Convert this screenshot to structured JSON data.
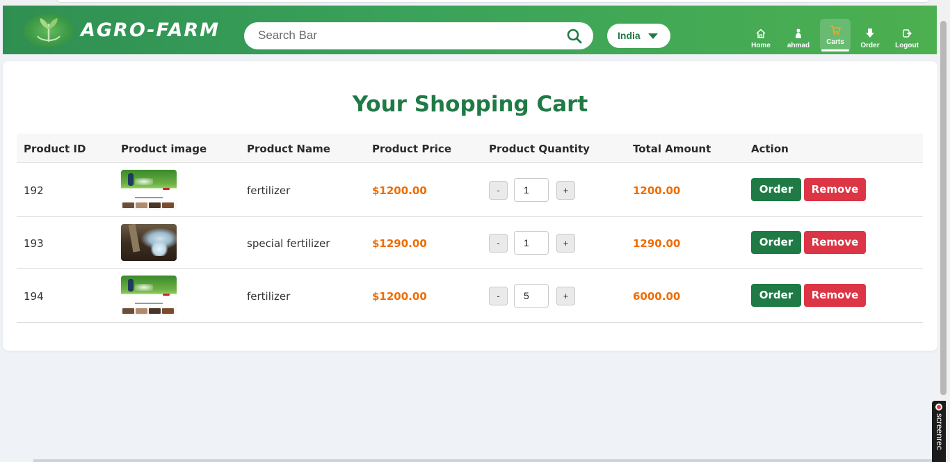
{
  "brand": {
    "name": "AGRO-FARM"
  },
  "search": {
    "placeholder": "Search Bar"
  },
  "country": {
    "selected": "India"
  },
  "nav": {
    "items": [
      {
        "label": "Home",
        "icon": "home-icon"
      },
      {
        "label": "ahmad",
        "icon": "user-icon"
      },
      {
        "label": "Carts",
        "icon": "cart-icon",
        "active": true
      },
      {
        "label": "Order",
        "icon": "order-icon"
      },
      {
        "label": "Logout",
        "icon": "logout-icon"
      }
    ]
  },
  "page": {
    "title": "Your Shopping Cart"
  },
  "table": {
    "headers": [
      "Product ID",
      "Product image",
      "Product Name",
      "Product Price",
      "Product Quantity",
      "Total Amount",
      "Action"
    ],
    "rows": [
      {
        "id": "192",
        "image": "fertilizer-field-image",
        "name": "fertilizer",
        "price": "$1200.00",
        "quantity": "1",
        "total": "1200.00"
      },
      {
        "id": "193",
        "image": "special-fertilizer-soil-image",
        "name": "special fertilizer",
        "price": "$1290.00",
        "quantity": "1",
        "total": "1290.00"
      },
      {
        "id": "194",
        "image": "fertilizer-field-image",
        "name": "fertilizer",
        "price": "$1200.00",
        "quantity": "5",
        "total": "6000.00"
      }
    ],
    "qty_minus": "-",
    "qty_plus": "+",
    "order_label": "Order",
    "remove_label": "Remove"
  },
  "overlay": {
    "screenrec": "screenrec"
  },
  "colors": {
    "brand_green": "#1f7a45",
    "nav_green": "#3aa35a",
    "price_orange": "#ef6c00",
    "remove_red": "#dc3545"
  }
}
